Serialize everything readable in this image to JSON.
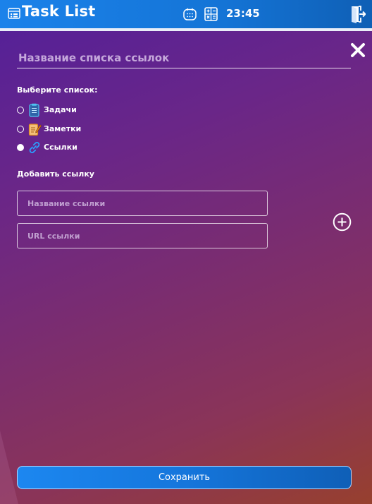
{
  "header": {
    "app_title": "Task List",
    "time": "23:45",
    "icons": [
      "task-list-logo-icon",
      "calendar-icon",
      "calculator-icon",
      "logout-door-icon"
    ]
  },
  "form": {
    "list_name_placeholder": "Название списка ссылок",
    "choose_list_label": "Выберите список:",
    "options": [
      {
        "label": "Задачи",
        "icon": "tasks-notepad-icon",
        "selected": false
      },
      {
        "label": "Заметки",
        "icon": "notes-pencil-icon",
        "selected": false
      },
      {
        "label": "Ссылки",
        "icon": "link-chain-icon",
        "selected": true
      }
    ],
    "add_link_label": "Добавить ссылку",
    "link_name_placeholder": "Название ссылки",
    "link_url_placeholder": "URL ссылки",
    "save_label": "Сохранить"
  },
  "colors": {
    "header_blue": "#1b82ea",
    "background_top": "#52209a",
    "background_bottom": "#97402e",
    "link_icon_blue": "#2aa0ff",
    "notes_icon_orange": "#f0a030"
  }
}
